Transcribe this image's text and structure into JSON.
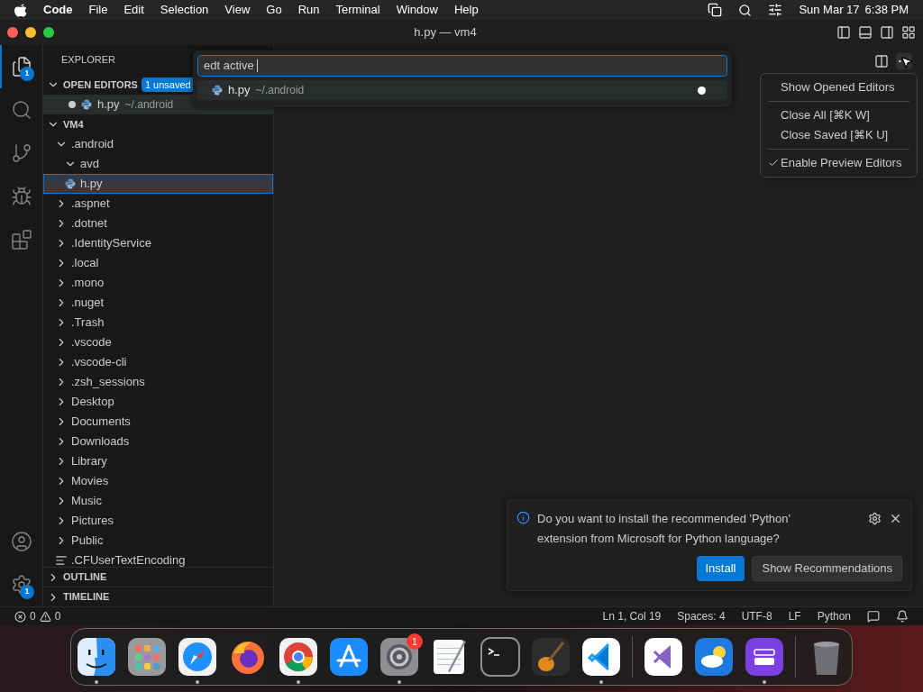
{
  "menu_bar": {
    "app": "Code",
    "items": [
      "File",
      "Edit",
      "Selection",
      "View",
      "Go",
      "Run",
      "Terminal",
      "Window",
      "Help"
    ],
    "date": "Sun Mar 17",
    "time": "6:38 PM"
  },
  "window": {
    "title": "h.py — vm4"
  },
  "activity_bar": {
    "top": [
      {
        "kind": "files",
        "selected": true,
        "badge": "1"
      },
      {
        "kind": "search",
        "selected": false
      },
      {
        "kind": "source-control",
        "selected": false
      },
      {
        "kind": "debug",
        "selected": false
      },
      {
        "kind": "extensions",
        "selected": false
      }
    ],
    "bottom": [
      {
        "kind": "account"
      },
      {
        "kind": "settings",
        "badge": "1"
      }
    ]
  },
  "sidebar": {
    "title": "EXPLORER",
    "open_editors": {
      "label": "OPEN EDITORS",
      "expanded": true,
      "badge": "1 unsaved",
      "files": [
        {
          "name": "h.py",
          "path": "~/.android",
          "dirty": true
        }
      ]
    },
    "folder": {
      "label": "VM4",
      "expanded": true,
      "children": [
        {
          "name": ".android",
          "kind": "folder",
          "expanded": true,
          "selected": false,
          "children": [
            {
              "name": "avd",
              "kind": "folder",
              "expanded": true,
              "selected": false
            },
            {
              "name": "h.py",
              "kind": "python",
              "selected": true
            }
          ]
        },
        {
          "name": ".aspnet",
          "kind": "folder",
          "expanded": false,
          "selected": false
        },
        {
          "name": ".dotnet",
          "kind": "folder",
          "expanded": false,
          "selected": false
        },
        {
          "name": ".IdentityService",
          "kind": "folder",
          "expanded": false,
          "selected": false
        },
        {
          "name": ".local",
          "kind": "folder",
          "expanded": false,
          "selected": false
        },
        {
          "name": ".mono",
          "kind": "folder",
          "expanded": false,
          "selected": false
        },
        {
          "name": ".nuget",
          "kind": "folder",
          "expanded": false,
          "selected": false
        },
        {
          "name": ".Trash",
          "kind": "folder",
          "expanded": false,
          "selected": false
        },
        {
          "name": ".vscode",
          "kind": "folder",
          "expanded": false,
          "selected": false
        },
        {
          "name": ".vscode-cli",
          "kind": "folder",
          "expanded": false,
          "selected": false
        },
        {
          "name": ".zsh_sessions",
          "kind": "folder",
          "expanded": false,
          "selected": false
        },
        {
          "name": "Desktop",
          "kind": "folder",
          "expanded": false,
          "selected": false
        },
        {
          "name": "Documents",
          "kind": "folder",
          "expanded": false,
          "selected": false
        },
        {
          "name": "Downloads",
          "kind": "folder",
          "expanded": false,
          "selected": false
        },
        {
          "name": "Library",
          "kind": "folder",
          "expanded": false,
          "selected": false
        },
        {
          "name": "Movies",
          "kind": "folder",
          "expanded": false,
          "selected": false
        },
        {
          "name": "Music",
          "kind": "folder",
          "expanded": false,
          "selected": false
        },
        {
          "name": "Pictures",
          "kind": "folder",
          "expanded": false,
          "selected": false
        },
        {
          "name": "Public",
          "kind": "folder",
          "expanded": false,
          "selected": false
        },
        {
          "name": ".CFUserTextEncoding",
          "kind": "text",
          "selected": false
        }
      ]
    },
    "sections": [
      {
        "label": "OUTLINE",
        "expanded": false
      },
      {
        "label": "TIMELINE",
        "expanded": false
      }
    ]
  },
  "quick_open": {
    "value": "edt active ",
    "results": [
      {
        "name": "h.py",
        "path": "~/.android",
        "dirty": true
      }
    ]
  },
  "context_menu": {
    "groups": [
      [
        {
          "label": "Show Opened Editors",
          "checked": false
        }
      ],
      [
        {
          "label": "Close All [⌘K W]",
          "checked": false
        },
        {
          "label": "Close Saved [⌘K U]",
          "checked": false
        }
      ],
      [
        {
          "label": "Enable Preview Editors",
          "checked": true
        }
      ]
    ]
  },
  "notification": {
    "message": "Do you want to install the recommended 'Python' extension from Microsoft for Python language?",
    "buttons": [
      {
        "label": "Install",
        "primary": true
      },
      {
        "label": "Show Recommendations",
        "primary": false
      }
    ]
  },
  "status_bar": {
    "errors": "0",
    "warnings": "0",
    "items": [
      "Ln 1, Col 19",
      "Spaces: 4",
      "UTF-8",
      "LF",
      "Python"
    ]
  },
  "dock": [
    {
      "kind": "finder",
      "running": true
    },
    {
      "kind": "launchpad",
      "running": false
    },
    {
      "kind": "safari",
      "running": true
    },
    {
      "kind": "firefox",
      "running": false
    },
    {
      "kind": "chrome",
      "running": true
    },
    {
      "kind": "appstore",
      "running": false
    },
    {
      "kind": "settings",
      "running": true,
      "badge": "1"
    },
    {
      "kind": "textedit",
      "running": false
    },
    {
      "kind": "terminal",
      "running": false
    },
    {
      "kind": "guitar",
      "running": false
    },
    {
      "kind": "vscode",
      "running": true
    },
    {
      "kind": "divider"
    },
    {
      "kind": "visualstudio",
      "running": false
    },
    {
      "kind": "weather",
      "running": false
    },
    {
      "kind": "drive",
      "running": true
    },
    {
      "kind": "divider"
    },
    {
      "kind": "trash",
      "running": false
    }
  ]
}
